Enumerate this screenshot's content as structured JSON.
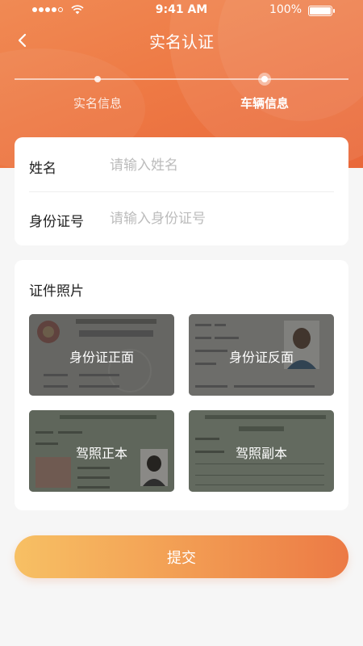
{
  "status_bar": {
    "time": "9:41 AM",
    "battery": "100%"
  },
  "nav": {
    "title": "实名认证"
  },
  "steps": [
    {
      "label": "实名信息",
      "active": false
    },
    {
      "label": "车辆信息",
      "active": true
    }
  ],
  "form": {
    "name_label": "姓名",
    "name_placeholder": "请输入姓名",
    "id_label": "身份证号",
    "id_placeholder": "请输入身份证号"
  },
  "photos": {
    "title": "证件照片",
    "items": [
      {
        "label": "身份证正面"
      },
      {
        "label": "身份证反面"
      },
      {
        "label": "驾照正本"
      },
      {
        "label": "驾照副本"
      }
    ]
  },
  "submit": {
    "label": "提交"
  },
  "colors": {
    "accent": "#ee7a45",
    "gradient_start": "#f7c064",
    "gradient_end": "#ec7a45"
  }
}
